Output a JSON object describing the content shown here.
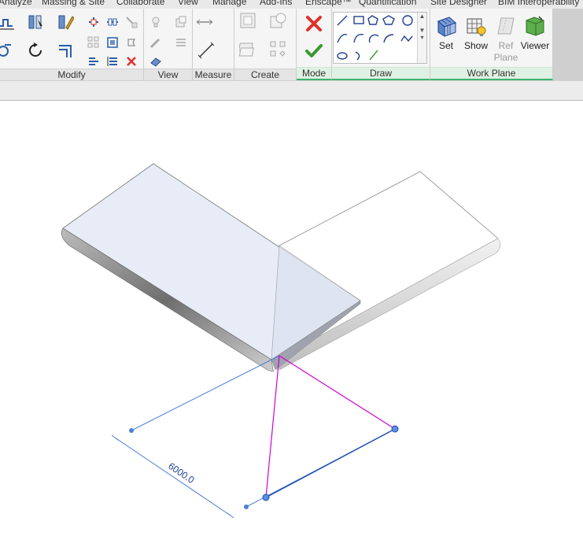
{
  "tabs": [
    {
      "label": "Analyze"
    },
    {
      "label": "Massing & Site"
    },
    {
      "label": "Collaborate"
    },
    {
      "label": "View"
    },
    {
      "label": "Manage"
    },
    {
      "label": "Add-Ins"
    },
    {
      "label": "Enscape™"
    },
    {
      "label": "Quantification"
    },
    {
      "label": "Site Designer"
    },
    {
      "label": "BIM Interoperability T"
    }
  ],
  "panels": {
    "modify": "Modify",
    "view": "View",
    "measure": "Measure",
    "create": "Create",
    "mode": "Mode",
    "draw": "Draw",
    "work_plane": "Work Plane"
  },
  "work_plane_buttons": {
    "set": "Set",
    "show": "Show",
    "ref_plane_line1": "Ref",
    "ref_plane_line2": "Plane",
    "viewer": "Viewer"
  },
  "canvas": {
    "dimension_value": "6000.0"
  },
  "colors": {
    "finish_icon": "#e0312b",
    "confirm_icon": "#3a9a2e",
    "sketch_line": "#d000d0",
    "dimension": "#4a7fd6",
    "panel_accent": "#3cb371"
  }
}
